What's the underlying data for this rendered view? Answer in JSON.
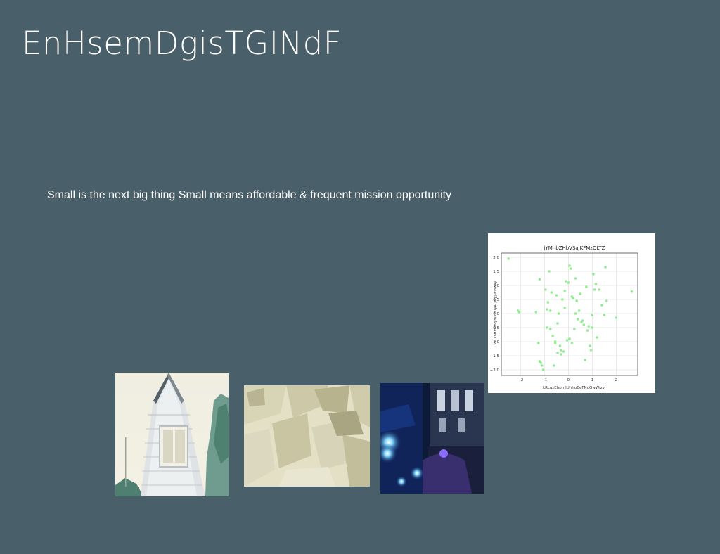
{
  "slide": {
    "title": "EnHsemDgisTGINdF",
    "subtitle": "Small is the next big thing Small means affordable & frequent mission opportunity"
  },
  "images": {
    "house": "house-photo",
    "abstract": "abstract-shapes-photo",
    "night": "night-lights-photo"
  },
  "chart_data": {
    "type": "scatter",
    "title": "jYMnbZHbVSajKFMzQLTZ",
    "xlabel": "LRcqzEhpmIUhhuBeFNoOwWjzy",
    "ylabel": "VALcnHmvBqjmXkcTyAQWyjvEHWay",
    "xlim": [
      -2.8,
      2.9
    ],
    "ylim": [
      -2.2,
      2.15
    ],
    "xticks": [
      -2,
      -1,
      0,
      1,
      2
    ],
    "yticks": [
      -2.0,
      -1.5,
      -1.0,
      -0.5,
      0.0,
      0.5,
      1.0,
      1.5,
      2.0
    ],
    "grid": true,
    "color": "#90ee90",
    "x": [
      -2.5,
      -2.1,
      -2.05,
      -1.35,
      -1.25,
      -1.2,
      -1.15,
      -1.1,
      -1.05,
      -1.2,
      -0.95,
      -0.9,
      -0.85,
      -0.8,
      -0.75,
      -0.7,
      -0.65,
      -0.6,
      -0.55,
      -0.5,
      -0.45,
      -0.4,
      -0.35,
      -0.3,
      -0.25,
      -0.2,
      -0.15,
      -0.1,
      -0.05,
      0.0,
      0.05,
      0.1,
      0.15,
      0.2,
      0.25,
      0.3,
      0.35,
      0.4,
      0.45,
      0.5,
      0.55,
      0.6,
      0.65,
      0.7,
      0.75,
      0.8,
      0.85,
      0.9,
      0.95,
      1.0,
      1.05,
      1.1,
      1.15,
      1.2,
      1.3,
      1.4,
      1.5,
      1.55,
      1.6,
      2.0,
      2.65,
      -0.3,
      -0.15,
      0.05,
      -0.55,
      -0.75,
      -0.9,
      0.15,
      0.3,
      -0.45,
      1.0
    ],
    "y": [
      1.95,
      0.1,
      0.05,
      0.05,
      -1.05,
      1.22,
      -1.75,
      -1.85,
      -2.0,
      -1.7,
      0.85,
      -0.5,
      0.4,
      1.5,
      0.1,
      0.75,
      -0.8,
      -1.85,
      -1.0,
      0.65,
      -0.35,
      0.0,
      -1.15,
      -1.3,
      0.5,
      -1.35,
      0.8,
      1.15,
      -0.95,
      1.1,
      1.7,
      1.6,
      0.6,
      0.55,
      -0.55,
      1.25,
      0.45,
      -0.2,
      0.1,
      0.7,
      -0.3,
      -0.25,
      -0.4,
      -1.65,
      0.95,
      -0.6,
      -0.45,
      -1.15,
      -1.3,
      -0.05,
      1.4,
      0.85,
      1.05,
      -0.85,
      0.85,
      0.3,
      -0.05,
      1.65,
      0.45,
      -0.15,
      0.78,
      -1.45,
      0.2,
      -0.9,
      -1.05,
      -0.55,
      0.15,
      -1.05,
      0.0,
      -1.4,
      -0.5
    ]
  }
}
